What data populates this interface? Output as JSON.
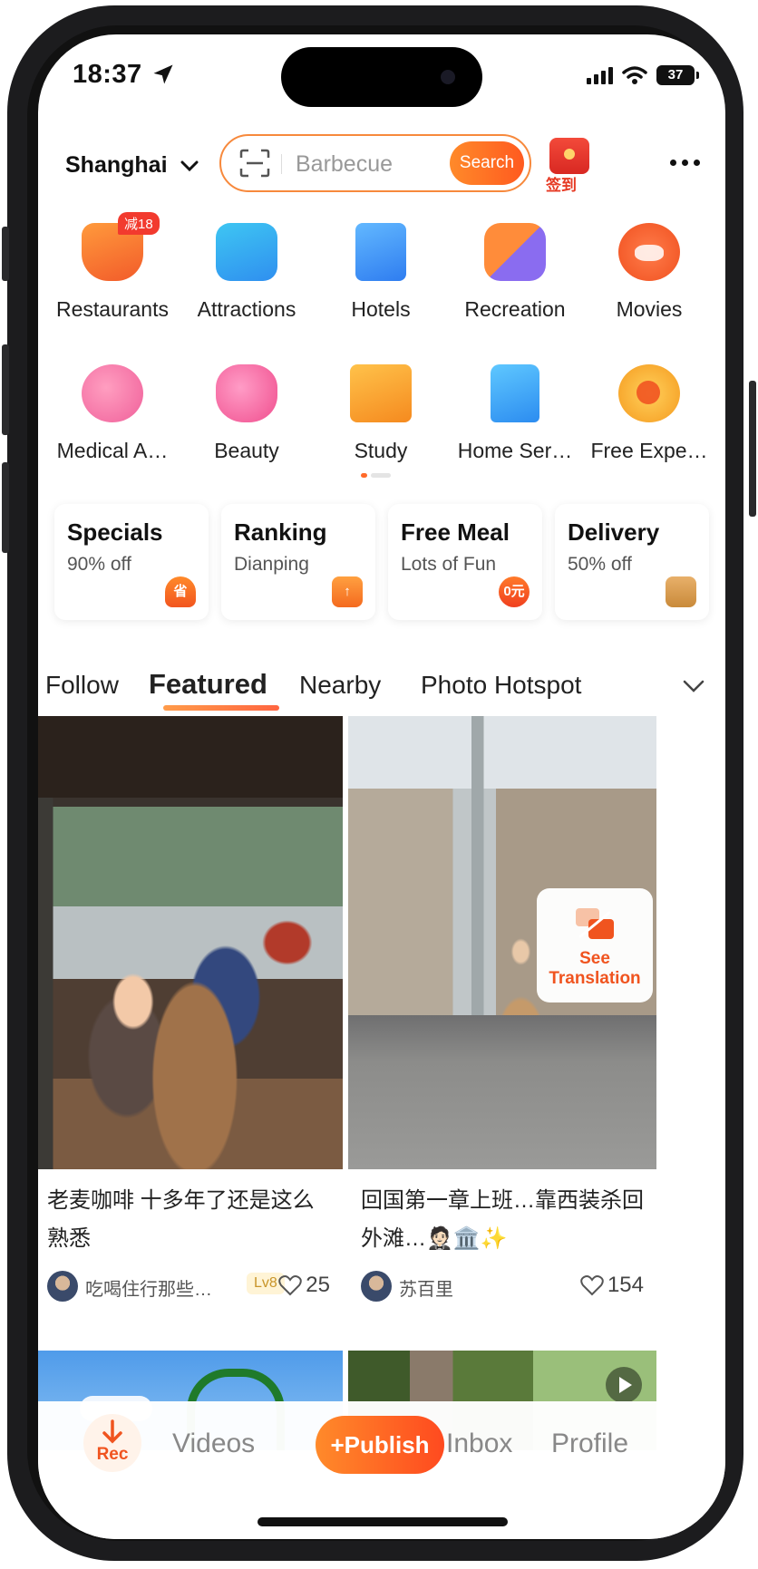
{
  "status_bar": {
    "time": "18:37",
    "battery": "37"
  },
  "header": {
    "city": "Shanghai",
    "search_placeholder": "Barbecue",
    "search_button": "Search",
    "checkin_label": "签到"
  },
  "categories": [
    {
      "label": "Restaurants",
      "icon": "restaurant-icon",
      "badge": "减18"
    },
    {
      "label": "Attractions",
      "icon": "attractions-icon"
    },
    {
      "label": "Hotels",
      "icon": "hotels-icon"
    },
    {
      "label": "Recreation",
      "icon": "recreation-icon"
    },
    {
      "label": "Movies",
      "icon": "movies-icon"
    },
    {
      "label": "Medical A…",
      "icon": "medical-icon"
    },
    {
      "label": "Beauty",
      "icon": "beauty-icon"
    },
    {
      "label": "Study",
      "icon": "study-icon"
    },
    {
      "label": "Home Ser…",
      "icon": "home-services-icon"
    },
    {
      "label": "Free Expe…",
      "icon": "free-experience-icon"
    }
  ],
  "promos": [
    {
      "title": "Specials",
      "subtitle": "90% off",
      "icon_text": "省"
    },
    {
      "title": "Ranking",
      "subtitle": "Dianping",
      "icon_text": "↑"
    },
    {
      "title": "Free Meal",
      "subtitle": "Lots of Fun",
      "icon_text": "0元"
    },
    {
      "title": "Delivery",
      "subtitle": "50% off",
      "icon_text": ""
    }
  ],
  "feed_tabs": [
    "Follow",
    "Featured",
    "Nearby",
    "Photo Hotspot"
  ],
  "active_tab": "Featured",
  "feed": [
    {
      "title": "老麦咖啡 十多年了还是这么熟悉",
      "author": "吃喝住行那些…",
      "level": "Lv8",
      "likes": "25"
    },
    {
      "title": "回国第一章上班…靠西装杀回外滩…🤵🏻🏛️✨",
      "author": "苏百里",
      "likes": "154",
      "translate_label": "See Translation"
    }
  ],
  "bottom_nav": {
    "rec": "Rec",
    "videos": "Videos",
    "publish": "+Publish",
    "inbox": "Inbox",
    "profile": "Profile"
  },
  "colors": {
    "accent": "#ff5a1f",
    "accent_light": "#ff8a2a"
  }
}
